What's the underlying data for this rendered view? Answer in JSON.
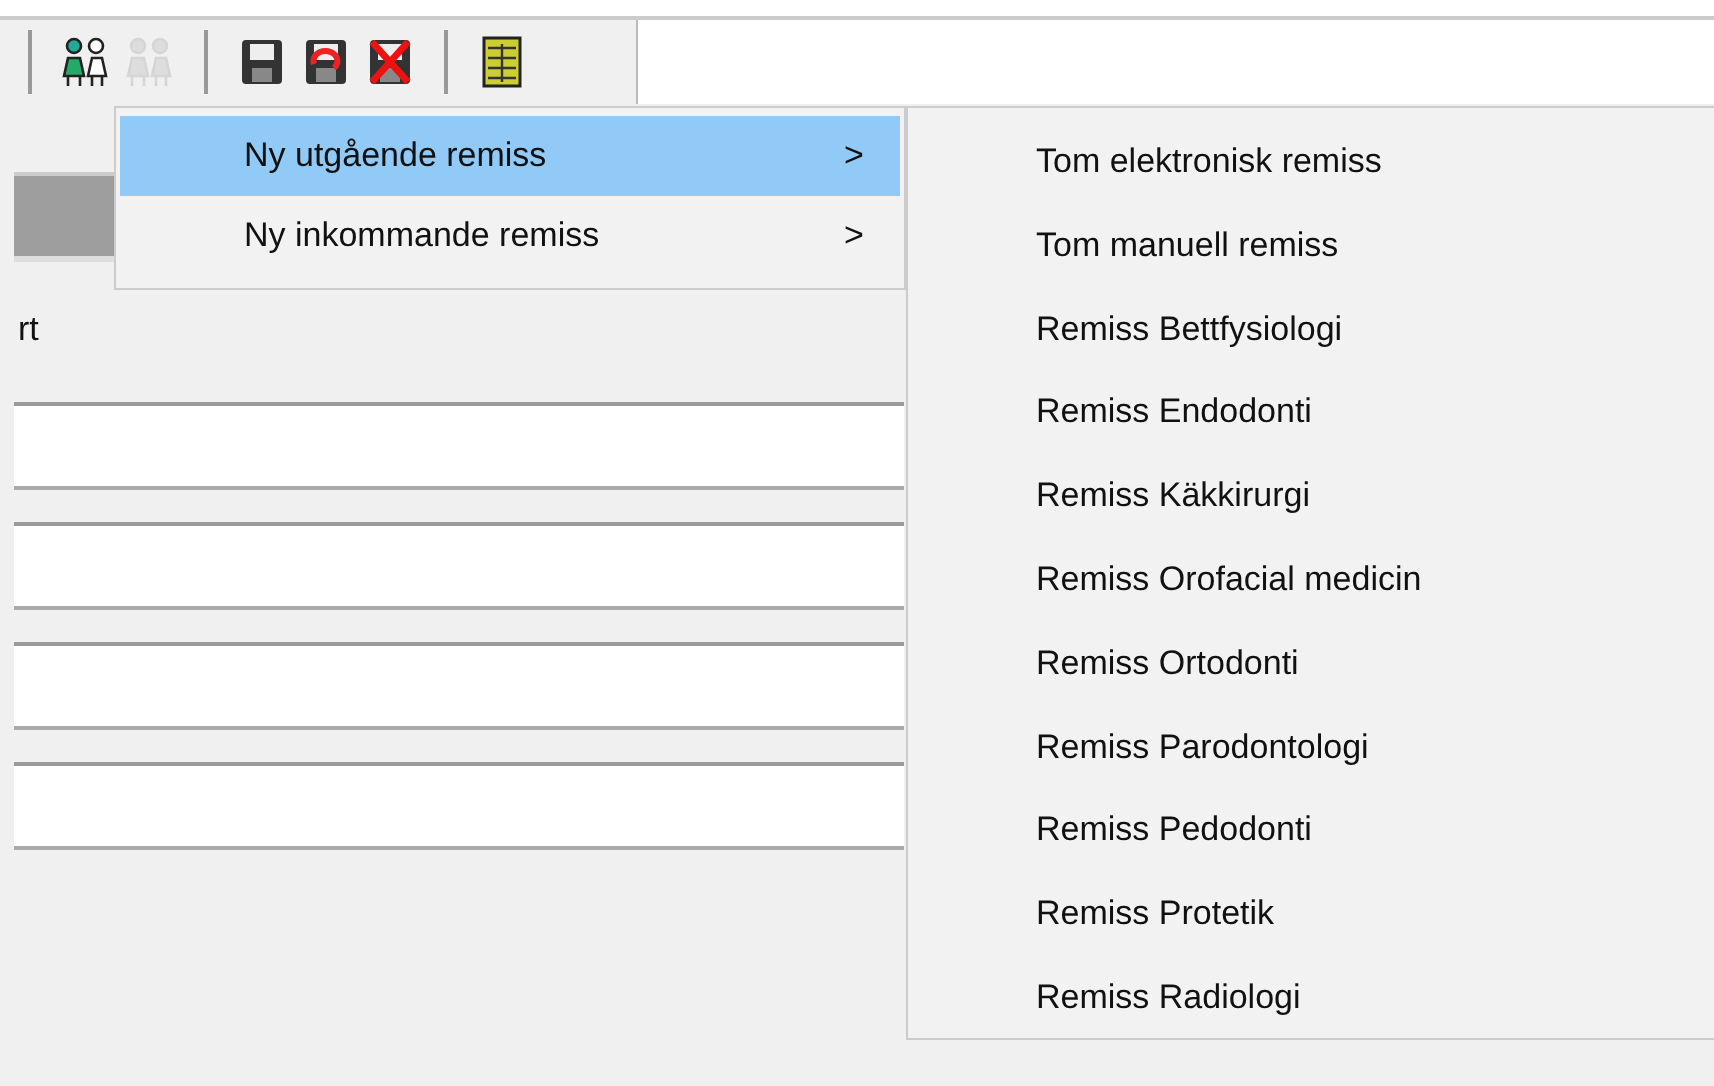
{
  "toolbar": [
    {
      "kind": "separator"
    },
    {
      "kind": "people",
      "disabled": false
    },
    {
      "kind": "people",
      "disabled": true
    },
    {
      "kind": "separator"
    },
    {
      "kind": "save"
    },
    {
      "kind": "undo"
    },
    {
      "kind": "delete"
    },
    {
      "kind": "separator"
    },
    {
      "kind": "book"
    }
  ],
  "form": {
    "label": "rt"
  },
  "menu": {
    "items": [
      {
        "label": "Ny utgående remiss",
        "arrow": ">",
        "selected": true
      },
      {
        "label": "Ny inkommande remiss",
        "arrow": ">",
        "selected": false
      }
    ]
  },
  "submenu": {
    "items": [
      "Tom elektronisk remiss",
      "Tom manuell remiss",
      "Remiss Bettfysiologi",
      "Remiss Endodonti",
      "Remiss Käkkirurgi",
      "Remiss Orofacial medicin",
      "Remiss Ortodonti",
      "Remiss Parodontologi",
      "Remiss Pedodonti",
      "Remiss Protetik",
      "Remiss Radiologi"
    ]
  }
}
